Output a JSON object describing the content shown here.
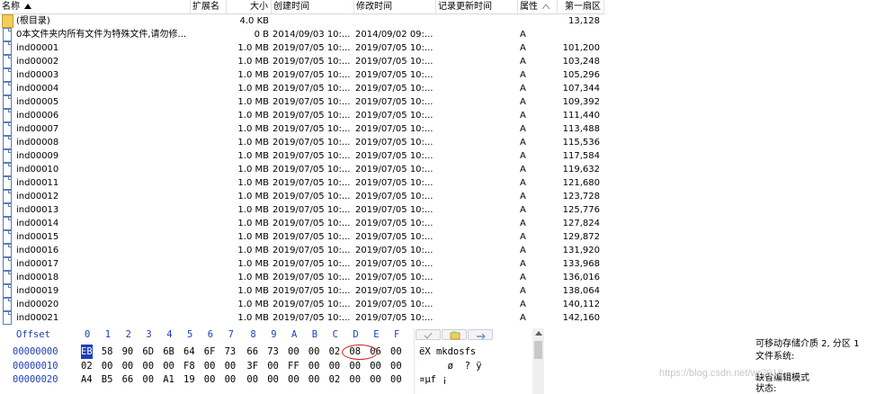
{
  "columns": {
    "name": "名称",
    "ext": "扩展名",
    "size": "大小",
    "created": "创建时间",
    "modified": "修改时间",
    "record_updated": "记录更新时间",
    "attr": "属性",
    "first_sector": "第一扇区"
  },
  "rows": [
    {
      "name": "(根目录)",
      "ext": "",
      "size": "4.0 KB",
      "created": "",
      "modified": "",
      "attr": "",
      "sector": "13,128",
      "icon": "folder-icon"
    },
    {
      "name": "0本文件夹内所有文件为特殊文件,请勿修...",
      "ext": "",
      "size": "0 B",
      "created": "2014/09/03  10:...",
      "modified": "2014/09/02  09:...",
      "attr": "A",
      "sector": "",
      "icon": "file-icon"
    },
    {
      "name": "ind00001",
      "ext": "",
      "size": "1.0 MB",
      "created": "2019/07/05  10:...",
      "modified": "2019/07/05  10:...",
      "attr": "A",
      "sector": "101,200",
      "icon": "file-icon"
    },
    {
      "name": "ind00002",
      "ext": "",
      "size": "1.0 MB",
      "created": "2019/07/05  10:...",
      "modified": "2019/07/05  10:...",
      "attr": "A",
      "sector": "103,248",
      "icon": "file-icon"
    },
    {
      "name": "ind00003",
      "ext": "",
      "size": "1.0 MB",
      "created": "2019/07/05  10:...",
      "modified": "2019/07/05  10:...",
      "attr": "A",
      "sector": "105,296",
      "icon": "file-icon"
    },
    {
      "name": "ind00004",
      "ext": "",
      "size": "1.0 MB",
      "created": "2019/07/05  10:...",
      "modified": "2019/07/05  10:...",
      "attr": "A",
      "sector": "107,344",
      "icon": "file-icon"
    },
    {
      "name": "ind00005",
      "ext": "",
      "size": "1.0 MB",
      "created": "2019/07/05  10:...",
      "modified": "2019/07/05  10:...",
      "attr": "A",
      "sector": "109,392",
      "icon": "file-icon"
    },
    {
      "name": "ind00006",
      "ext": "",
      "size": "1.0 MB",
      "created": "2019/07/05  10:...",
      "modified": "2019/07/05  10:...",
      "attr": "A",
      "sector": "111,440",
      "icon": "file-icon"
    },
    {
      "name": "ind00007",
      "ext": "",
      "size": "1.0 MB",
      "created": "2019/07/05  10:...",
      "modified": "2019/07/05  10:...",
      "attr": "A",
      "sector": "113,488",
      "icon": "file-icon"
    },
    {
      "name": "ind00008",
      "ext": "",
      "size": "1.0 MB",
      "created": "2019/07/05  10:...",
      "modified": "2019/07/05  10:...",
      "attr": "A",
      "sector": "115,536",
      "icon": "file-icon"
    },
    {
      "name": "ind00009",
      "ext": "",
      "size": "1.0 MB",
      "created": "2019/07/05  10:...",
      "modified": "2019/07/05  10:...",
      "attr": "A",
      "sector": "117,584",
      "icon": "file-icon"
    },
    {
      "name": "ind00010",
      "ext": "",
      "size": "1.0 MB",
      "created": "2019/07/05  10:...",
      "modified": "2019/07/05  10:...",
      "attr": "A",
      "sector": "119,632",
      "icon": "file-icon"
    },
    {
      "name": "ind00011",
      "ext": "",
      "size": "1.0 MB",
      "created": "2019/07/05  10:...",
      "modified": "2019/07/05  10:...",
      "attr": "A",
      "sector": "121,680",
      "icon": "file-icon"
    },
    {
      "name": "ind00012",
      "ext": "",
      "size": "1.0 MB",
      "created": "2019/07/05  10:...",
      "modified": "2019/07/05  10:...",
      "attr": "A",
      "sector": "123,728",
      "icon": "file-icon"
    },
    {
      "name": "ind00013",
      "ext": "",
      "size": "1.0 MB",
      "created": "2019/07/05  10:...",
      "modified": "2019/07/05  10:...",
      "attr": "A",
      "sector": "125,776",
      "icon": "file-icon"
    },
    {
      "name": "ind00014",
      "ext": "",
      "size": "1.0 MB",
      "created": "2019/07/05  10:...",
      "modified": "2019/07/05  10:...",
      "attr": "A",
      "sector": "127,824",
      "icon": "file-icon"
    },
    {
      "name": "ind00015",
      "ext": "",
      "size": "1.0 MB",
      "created": "2019/07/05  10:...",
      "modified": "2019/07/05  10:...",
      "attr": "A",
      "sector": "129,872",
      "icon": "file-icon"
    },
    {
      "name": "ind00016",
      "ext": "",
      "size": "1.0 MB",
      "created": "2019/07/05  10:...",
      "modified": "2019/07/05  10:...",
      "attr": "A",
      "sector": "131,920",
      "icon": "file-icon"
    },
    {
      "name": "ind00017",
      "ext": "",
      "size": "1.0 MB",
      "created": "2019/07/05  10:...",
      "modified": "2019/07/05  10:...",
      "attr": "A",
      "sector": "133,968",
      "icon": "file-icon"
    },
    {
      "name": "ind00018",
      "ext": "",
      "size": "1.0 MB",
      "created": "2019/07/05  10:...",
      "modified": "2019/07/05  10:...",
      "attr": "A",
      "sector": "136,016",
      "icon": "file-icon"
    },
    {
      "name": "ind00019",
      "ext": "",
      "size": "1.0 MB",
      "created": "2019/07/05  10:...",
      "modified": "2019/07/05  10:...",
      "attr": "A",
      "sector": "138,064",
      "icon": "file-icon"
    },
    {
      "name": "ind00020",
      "ext": "",
      "size": "1.0 MB",
      "created": "2019/07/05  10:...",
      "modified": "2019/07/05  10:...",
      "attr": "A",
      "sector": "140,112",
      "icon": "file-icon"
    },
    {
      "name": "ind00021",
      "ext": "",
      "size": "1.0 MB",
      "created": "2019/07/05  10:...",
      "modified": "2019/07/05  10:...",
      "attr": "A",
      "sector": "142,160",
      "icon": "file-icon"
    }
  ],
  "hex": {
    "offset_label": "Offset",
    "col_labels": [
      "0",
      "1",
      "2",
      "3",
      "4",
      "5",
      "6",
      "7",
      "8",
      "9",
      "A",
      "B",
      "C",
      "D",
      "E",
      "F"
    ],
    "rows": [
      {
        "offset": "00000000",
        "bytes": [
          "EB",
          "58",
          "90",
          "6D",
          "6B",
          "64",
          "6F",
          "73",
          "66",
          "73",
          "00",
          "00",
          "02",
          "08",
          "06",
          "00"
        ],
        "ascii": "ëX mkdosfs"
      },
      {
        "offset": "00000010",
        "bytes": [
          "02",
          "00",
          "00",
          "00",
          "00",
          "F8",
          "00",
          "00",
          "3F",
          "00",
          "FF",
          "00",
          "00",
          "00",
          "00",
          "00"
        ],
        "ascii": "     ø  ? ÿ"
      },
      {
        "offset": "00000020",
        "bytes": [
          "A4",
          "B5",
          "66",
          "00",
          "A1",
          "19",
          "00",
          "00",
          "00",
          "00",
          "00",
          "00",
          "02",
          "00",
          "00",
          "00"
        ],
        "ascii": "¤µf ¡"
      }
    ],
    "selected_byte": "EB",
    "highlight_byte": "08",
    "selection_color": "#1e3fb8",
    "offset_color": "#1e3fb8",
    "circle_color": "#d02020"
  },
  "info": {
    "line1": "可移动存储介质 2, 分区 1",
    "line2": "文件系统:",
    "line3": "缺省编辑模式",
    "line4": "状态:"
  },
  "watermark": "https://blog.csdn.net/wr2018"
}
